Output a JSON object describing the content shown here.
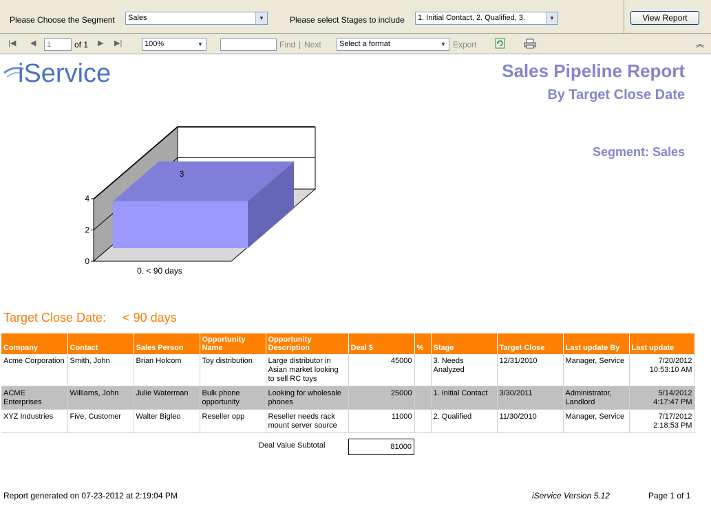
{
  "params": {
    "segment_label": "Please Choose the Segment",
    "segment_value": "Sales",
    "stages_label": "Please select Stages to include",
    "stages_value": "1. Initial Contact, 2. Qualified, 3.",
    "view_report_label": "View Report"
  },
  "toolbar": {
    "page_current": "1",
    "page_of": "of 1",
    "zoom_value": "100%",
    "find_label": "Find",
    "separator": "|",
    "next_label": "Next",
    "format_value": "Select a format",
    "export_label": "Export"
  },
  "report": {
    "logo_text": "iService",
    "title": "Sales Pipeline Report",
    "subtitle": "By Target Close Date",
    "segment": "Segment: Sales",
    "group_label": "Target Close Date:",
    "group_value": "< 90 days",
    "columns": [
      "Company",
      "Contact",
      "Sales Person",
      "Opportunity Name",
      "Opportunity Description",
      "Deal $",
      "%",
      "Stage",
      "Target Close",
      "Last update By",
      "Last update"
    ],
    "rows": [
      {
        "company": "Acme Corporation",
        "contact": "Smith, John",
        "sales_person": "Brian Holcom",
        "opp_name": "Toy distribution",
        "opp_desc": "Large distributor in Asian market looking to sell RC toys",
        "deal": "45000",
        "pct": "",
        "stage": "3. Needs Analyzed",
        "target_close": "12/31/2010",
        "last_by": "Manager, Service",
        "last_update_date": "7/20/2012",
        "last_update_time": "10:53:10 AM"
      },
      {
        "company": "ACME Enterprises",
        "contact": "Williams, John",
        "sales_person": "Julie Waterman",
        "opp_name": "Bulk phone opportunity",
        "opp_desc": "Looking for wholesale phones",
        "deal": "25000",
        "pct": "",
        "stage": "1. Initial Contact",
        "target_close": "3/30/2011",
        "last_by": "Administrator, Landlord",
        "last_update_date": "5/14/2012",
        "last_update_time": "4:17:47 PM"
      },
      {
        "company": "XYZ Industries",
        "contact": "Five, Customer",
        "sales_person": "Walter Bigleo",
        "opp_name": "Reseller opp",
        "opp_desc": "Reseller needs rack mount server source",
        "deal": "11000",
        "pct": "",
        "stage": "2. Qualified",
        "target_close": "11/30/2010",
        "last_by": "Manager, Service",
        "last_update_date": "7/17/2012",
        "last_update_time": "2:18:53 PM"
      }
    ],
    "subtotal_label": "Deal Value Subtotal",
    "subtotal_value": "81000",
    "footer_generated": "Report generated on 07-23-2012 at 2:19:04 PM",
    "footer_version": "iService Version 5.12",
    "footer_page": "Page 1 of 1"
  },
  "chart_data": {
    "type": "bar",
    "categories": [
      "0. < 90 days"
    ],
    "values": [
      3
    ],
    "ylim": [
      0,
      4
    ],
    "yticks": [
      0,
      2,
      4
    ],
    "data_labels": [
      "3"
    ],
    "grid": true,
    "bar_color": "#9999ff"
  },
  "colors": {
    "title": "#8585cc",
    "accent_orange": "#ff8000",
    "alt_row": "#c0c0c0"
  }
}
